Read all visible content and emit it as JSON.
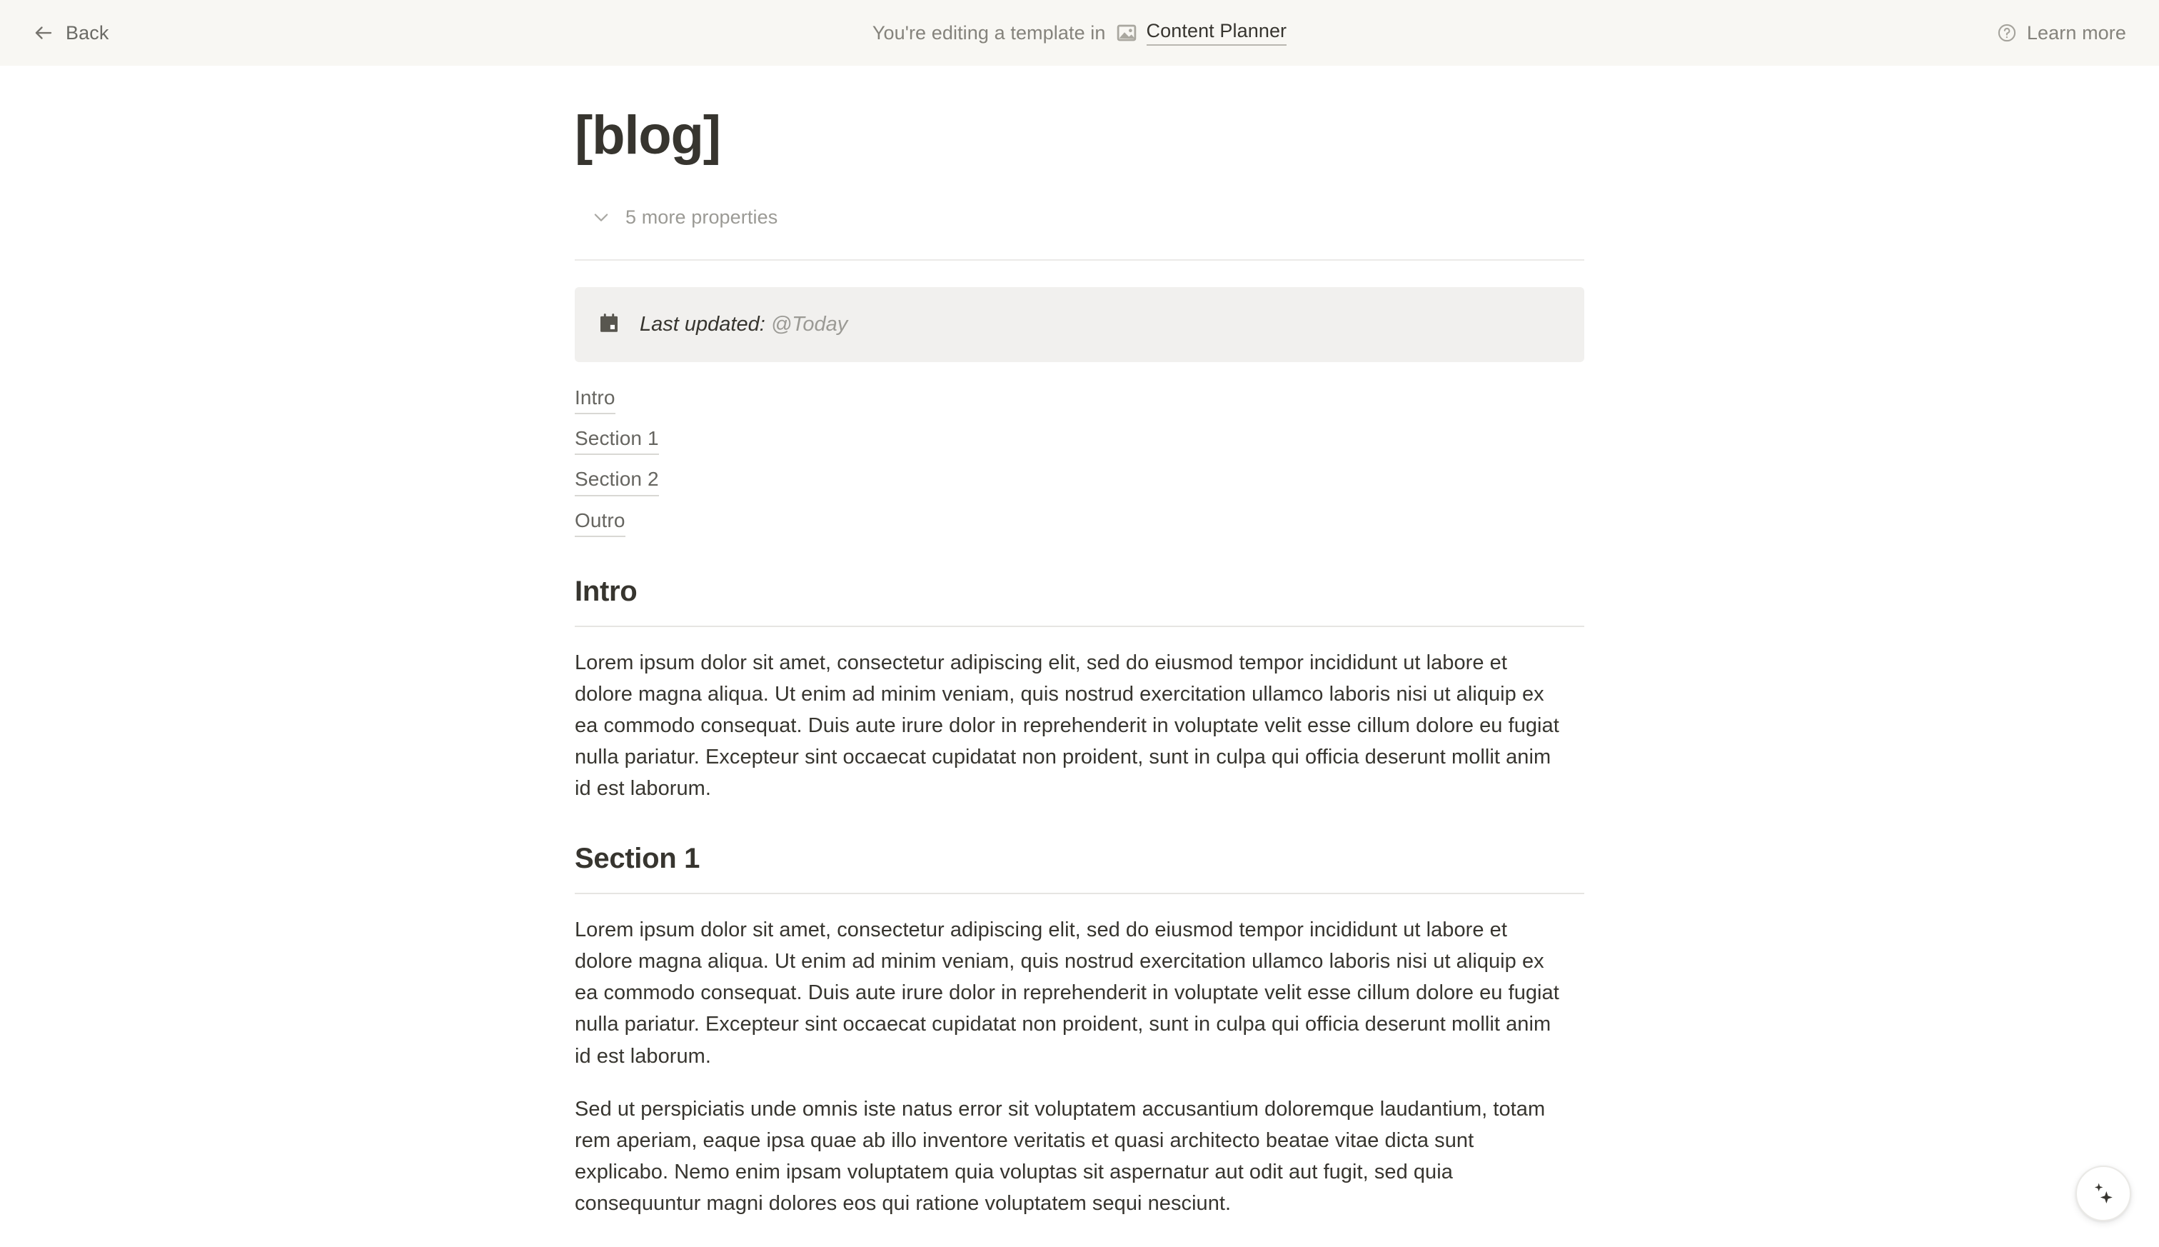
{
  "banner": {
    "back_label": "Back",
    "back_icon": "arrow-left-icon",
    "message": "You're editing a template in",
    "database_icon": "image-icon",
    "database_name": "Content Planner",
    "learn_more_label": "Learn more",
    "learn_more_icon": "question-circle-icon",
    "background_color": "#F8F7F3"
  },
  "page": {
    "title": "[blog]",
    "properties_toggle": {
      "label": "5 more properties",
      "icon": "chevron-down-icon"
    },
    "callout": {
      "icon": "calendar-icon",
      "label": "Last updated:",
      "mention": "@Today",
      "background_color": "#F1F0EE"
    },
    "table_of_contents": [
      {
        "label": "Intro"
      },
      {
        "label": "Section 1"
      },
      {
        "label": "Section 2"
      },
      {
        "label": "Outro"
      }
    ],
    "sections": [
      {
        "heading": "Intro",
        "paragraphs": [
          "Lorem ipsum dolor sit amet, consectetur adipiscing elit, sed do eiusmod tempor incididunt ut labore et dolore magna aliqua. Ut enim ad minim veniam, quis nostrud exercitation ullamco laboris nisi ut aliquip ex ea commodo consequat. Duis aute irure dolor in reprehenderit in voluptate velit esse cillum dolore eu fugiat nulla pariatur. Excepteur sint occaecat cupidatat non proident, sunt in culpa qui officia deserunt mollit anim id est laborum."
        ]
      },
      {
        "heading": "Section 1",
        "paragraphs": [
          "Lorem ipsum dolor sit amet, consectetur adipiscing elit, sed do eiusmod tempor incididunt ut labore et dolore magna aliqua. Ut enim ad minim veniam, quis nostrud exercitation ullamco laboris nisi ut aliquip ex ea commodo consequat. Duis aute irure dolor in reprehenderit in voluptate velit esse cillum dolore eu fugiat nulla pariatur. Excepteur sint occaecat cupidatat non proident, sunt in culpa qui officia deserunt mollit anim id est laborum.",
          "Sed ut perspiciatis unde omnis iste natus error sit voluptatem accusantium doloremque laudantium, totam rem aperiam, eaque ipsa quae ab illo inventore veritatis et quasi architecto beatae vitae dicta sunt explicabo. Nemo enim ipsam voluptatem quia voluptas sit aspernatur aut odit aut fugit, sed quia consequuntur magni dolores eos qui ratione voluptatem sequi nesciunt."
        ]
      }
    ]
  },
  "ai_button": {
    "icon": "sparkle-icon"
  }
}
